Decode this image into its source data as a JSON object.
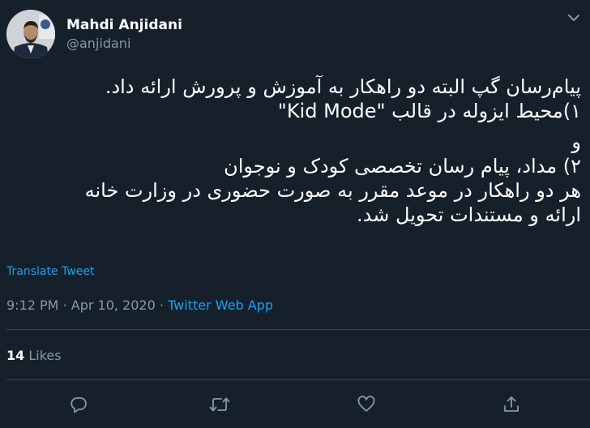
{
  "author": {
    "display_name": "Mahdi Anjidani",
    "handle": "@anjidani"
  },
  "tweet": {
    "lines": [
      "پیام‌رسان گپ البته دو راهکار به آموزش و پرورش ارائه داد.",
      "۱)محیط ایزوله در قالب \"Kid Mode\"",
      "",
      "و",
      "۲) مداد، پیام رسان تخصصی کودک و نوجوان",
      "هر دو راهکار در موعد مقرر به صورت حضوری در وزارت خانه",
      "ارائه و مستندات تحویل شد."
    ],
    "translate_label": "Translate Tweet",
    "time": "9:12 PM",
    "separator": "·",
    "date": "Apr 10, 2020",
    "source": "Twitter Web App",
    "likes_count": "14",
    "likes_label": "Likes"
  },
  "colors": {
    "background": "#15202b",
    "text": "#ffffff",
    "muted": "#8899a6",
    "accent": "#1da1f2",
    "divider": "#38444d"
  },
  "icons": {
    "more": "chevron-down-icon",
    "reply": "reply-icon",
    "retweet": "retweet-icon",
    "like": "heart-icon",
    "share": "share-icon"
  }
}
